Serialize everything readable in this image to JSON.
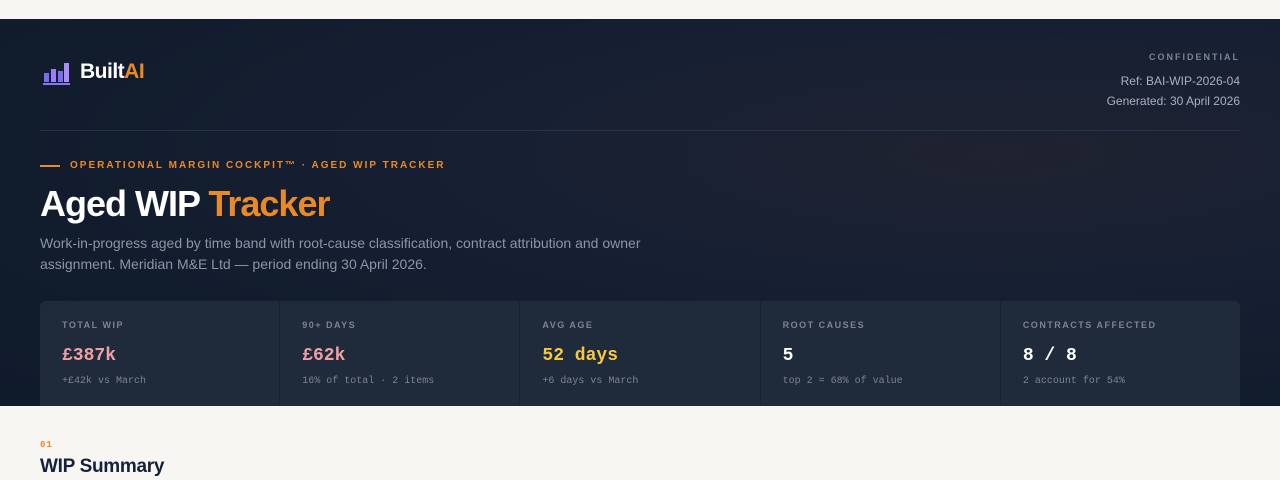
{
  "brand": {
    "name_main": "Built",
    "name_accent": "AI",
    "icon": "bar-chart-logo-icon"
  },
  "meta": {
    "confidential": "CONFIDENTIAL",
    "ref": "Ref: BAI-WIP-2026-04",
    "generated": "Generated: 30 April 2026"
  },
  "eyebrow": "OPERATIONAL MARGIN COCKPIT™ · AGED WIP TRACKER",
  "title": {
    "main": "Aged WIP ",
    "accent": "Tracker"
  },
  "description": "Work-in-progress aged by time band with root-cause classification, contract attribution and owner assignment. Meridian M&E Ltd — period ending 30 April 2026.",
  "kpis": [
    {
      "label": "TOTAL WIP",
      "value": "£387k",
      "sub": "+£42k vs March"
    },
    {
      "label": "90+ DAYS",
      "value": "£62k",
      "sub": "16% of total · 2 items"
    },
    {
      "label": "AVG AGE",
      "value": "52 days",
      "sub": "+6 days vs March"
    },
    {
      "label": "ROOT CAUSES",
      "value": "5",
      "sub": "top 2 = 68% of value"
    },
    {
      "label": "CONTRACTS AFFECTED",
      "value": "8 / 8",
      "sub": "2 account for 54%"
    }
  ],
  "colors": {
    "accent": "#e8892a",
    "hero_bg": "#111c2d",
    "kpi_pink": "#f0a0a4",
    "kpi_yellow": "#f5c842"
  },
  "section": {
    "number": "01",
    "title": "WIP Summary"
  }
}
